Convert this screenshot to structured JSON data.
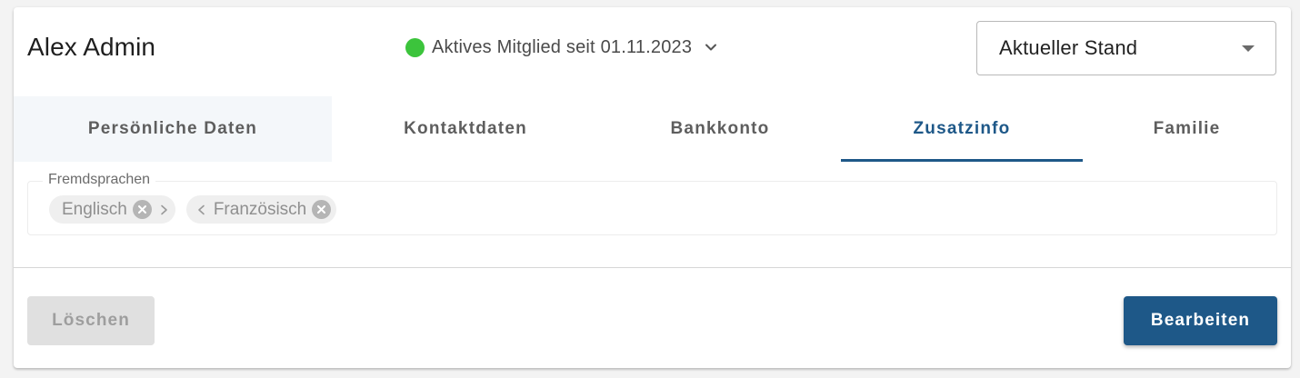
{
  "member": {
    "name": "Alex Admin",
    "status_text": "Aktives Mitglied seit 01.11.2023",
    "status_color": "#3cc43c"
  },
  "version_select": {
    "value": "Aktueller Stand"
  },
  "tabs": [
    {
      "label": "Persönliche Daten"
    },
    {
      "label": "Kontaktdaten"
    },
    {
      "label": "Bankkonto"
    },
    {
      "label": "Zusatzinfo"
    },
    {
      "label": "Familie"
    }
  ],
  "active_tab": "Zusatzinfo",
  "languages_field": {
    "label": "Fremdsprachen",
    "chips": [
      {
        "text": "Englisch"
      },
      {
        "text": "Französisch"
      }
    ]
  },
  "actions": {
    "delete_label": "Löschen",
    "edit_label": "Bearbeiten"
  },
  "colors": {
    "accent": "#1e5888",
    "status_active": "#3cc43c"
  },
  "icons": [
    "chevron-down-icon",
    "dropdown-caret-icon",
    "close-circle-icon",
    "chevron-right-icon",
    "chevron-left-icon"
  ]
}
